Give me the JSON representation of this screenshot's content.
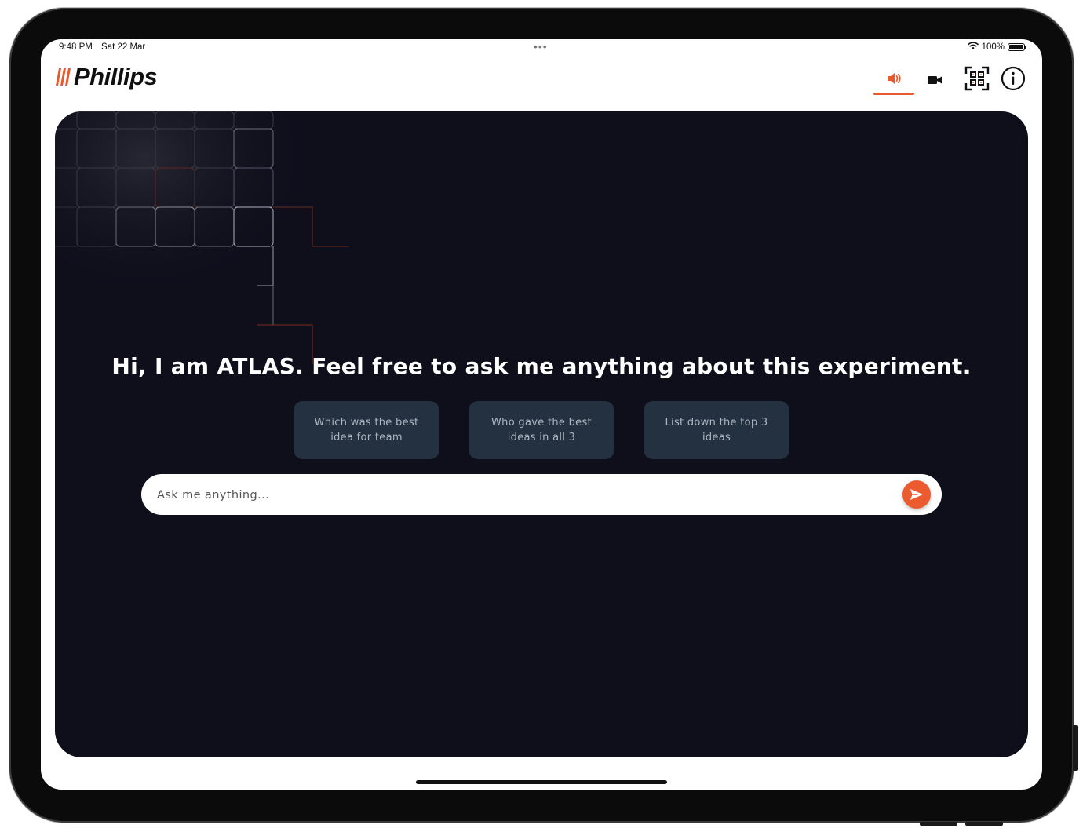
{
  "status_bar": {
    "time": "9:48 PM",
    "date": "Sat 22 Mar",
    "battery": "100%",
    "battery_level": 1.0
  },
  "header": {
    "logo_text": "Phillips",
    "icons": [
      "speaker-icon",
      "video-camera-icon",
      "qr-scan-icon",
      "info-icon"
    ],
    "active_icon": "speaker-icon"
  },
  "chat": {
    "greeting": "Hi, I am ATLAS. Feel free to ask me anything about this experiment.",
    "suggestions": [
      "Which was the best idea for team",
      "Who gave the best ideas in all 3",
      "List down the top 3 ideas"
    ],
    "input_placeholder": "Ask me anything...",
    "input_value": ""
  },
  "colors": {
    "accent": "#EC5A2F",
    "panel_bg": "#0F0E1B",
    "chip_bg": "#233140"
  }
}
